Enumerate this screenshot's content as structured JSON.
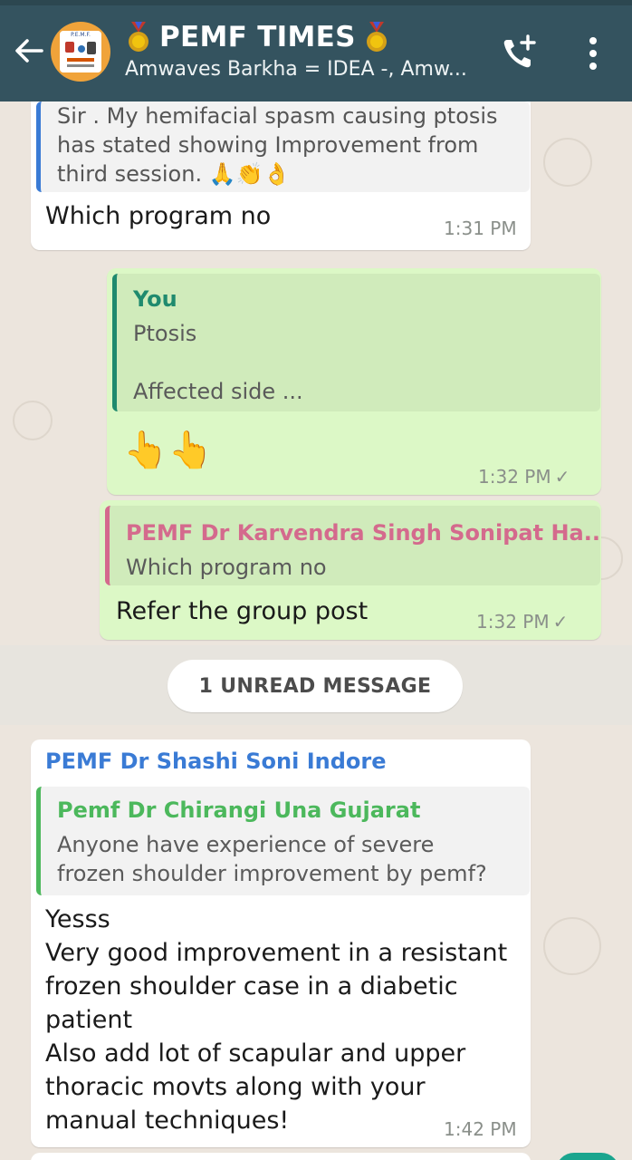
{
  "header": {
    "title": "PEMF TIMES",
    "subtitle": "Amwaves Barkha = IDEA -, Amw...",
    "avatar_text": "P.E.M.F."
  },
  "messages": [
    {
      "id": "m1",
      "quote_text": "Sir . My hemifacial spasm causing ptosis\nhas stated showing Improvement from\nthird session. 🙏👏👌",
      "text": "Which program no",
      "time": "1:31 PM"
    },
    {
      "id": "m2",
      "quote_name": "You",
      "quote_text": "Ptosis\n\nAffected side ...",
      "text": "👆👆",
      "time": "1:32 PM",
      "status": "✓"
    },
    {
      "id": "m3",
      "quote_name": "PEMF Dr Karvendra Singh Sonipat Ha...",
      "quote_text": "Which program no",
      "text": "Refer the group post",
      "time": "1:32 PM",
      "status": "✓"
    },
    {
      "id": "m4",
      "sender": "PEMF Dr Shashi Soni Indore",
      "quote_name": "Pemf Dr Chirangi Una Gujarat",
      "quote_text": "Anyone  have  experience of  severe\nfrozen shoulder improvement by  pemf?",
      "text": "Yesss\nVery good improvement in a resistant\nfrozen shoulder case in a diabetic\npatient\nAlso add lot of scapular and upper\nthoracic movts along with your\nmanual techniques!",
      "time": "1:42 PM"
    }
  ],
  "unread_label": "1 UNREAD MESSAGE",
  "colors": {
    "header": "#34535f",
    "incoming": "#ffffff",
    "outgoing": "#dcf8c6",
    "chat_bg": "#ece5dd",
    "sender_blue": "#3a7bd5",
    "you_green": "#1f8a6e",
    "quote_pink": "#d46a8d",
    "quote_green": "#4cb85c"
  }
}
